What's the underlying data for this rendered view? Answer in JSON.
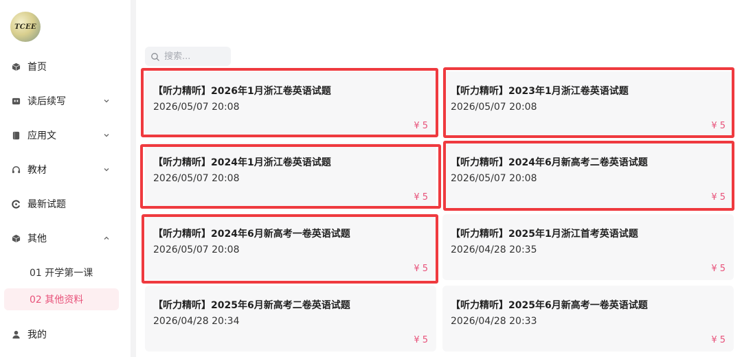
{
  "sidebar": {
    "avatar_text": "TCEE",
    "items": [
      {
        "label": "首页",
        "icon": "cube-icon",
        "chevron": null
      },
      {
        "label": "读后续写",
        "icon": "book-icon",
        "chevron": "chevron-down"
      },
      {
        "label": "应用文",
        "icon": "document-icon",
        "chevron": "chevron-down"
      },
      {
        "label": "教材",
        "icon": "headphones-icon",
        "chevron": "chevron-down"
      },
      {
        "label": "最新试题",
        "icon": "refresh-icon",
        "chevron": null
      },
      {
        "label": "其他",
        "icon": "cube-icon",
        "chevron": "chevron-up"
      }
    ],
    "subitems": [
      {
        "label": "01 开学第一课",
        "active": false
      },
      {
        "label": "02 其他资料",
        "active": true
      }
    ],
    "mine": {
      "label": "我的",
      "icon": "user-icon"
    }
  },
  "search": {
    "placeholder": "搜索...",
    "value": ""
  },
  "cards": [
    {
      "title": "【听力精听】2026年1月浙江卷英语试题",
      "date": "2026/05/07 20:08",
      "price": "¥ 5",
      "highlighted": true
    },
    {
      "title": "【听力精听】2023年1月浙江卷英语试题",
      "date": "2026/05/07 20:08",
      "price": "¥ 5",
      "highlighted": true
    },
    {
      "title": "【听力精听】2024年1月浙江卷英语试题",
      "date": "2026/05/07 20:08",
      "price": "¥ 5",
      "highlighted": true
    },
    {
      "title": "【听力精听】2024年6月新高考二卷英语试题",
      "date": "2026/05/07 20:08",
      "price": "¥ 5",
      "highlighted": true
    },
    {
      "title": "【听力精听】2024年6月新高考一卷英语试题",
      "date": "2026/05/07 20:08",
      "price": "¥ 5",
      "highlighted": true
    },
    {
      "title": "【听力精听】2025年1月浙江首考英语试题",
      "date": "2026/04/28 20:35",
      "price": "¥ 5",
      "highlighted": false
    },
    {
      "title": "【听力精听】2025年6月新高考二卷英语试题",
      "date": "2026/04/28 20:34",
      "price": "¥ 5",
      "highlighted": false
    },
    {
      "title": "【听力精听】2025年6月新高考一卷英语试题",
      "date": "2026/04/28 20:33",
      "price": "¥ 5",
      "highlighted": false
    }
  ],
  "colors": {
    "accent": "#e8527a",
    "highlight_border": "#ef3a3f",
    "card_bg": "#f7f7f8",
    "active_sub_bg": "#fdeff1"
  }
}
